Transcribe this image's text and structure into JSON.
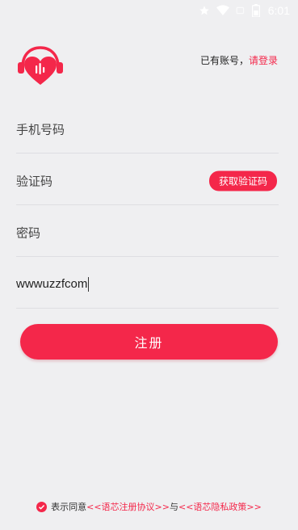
{
  "status_bar": {
    "time": "6:01",
    "icons": [
      "star-icon",
      "wifi-icon",
      "signal-icon",
      "battery-icon"
    ]
  },
  "header": {
    "login_prefix": "已有账号，",
    "login_link": "请登录"
  },
  "form": {
    "phone_placeholder": "手机号码",
    "code_placeholder": "验证码",
    "get_code_label": "获取验证码",
    "password_placeholder": "密码",
    "invite_value": "wwwuzzfcom"
  },
  "register_label": "注册",
  "agreement": {
    "prefix": "表示同意",
    "terms": "<<语芯注册协议>>",
    "and": "与",
    "privacy": "<<语芯隐私政策>>"
  },
  "colors": {
    "accent": "#f4274a",
    "background": "#efeff1"
  }
}
